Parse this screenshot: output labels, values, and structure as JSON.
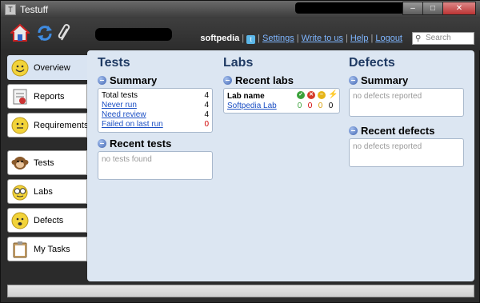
{
  "window": {
    "title": "Testuff",
    "controls": [
      "–",
      "□",
      "✕"
    ]
  },
  "topbar": {
    "username": "softpedia",
    "links": [
      "Settings",
      "Write to us",
      "Help",
      "Logout"
    ],
    "search_placeholder": "Search"
  },
  "sidebar": {
    "items": [
      {
        "label": "Overview",
        "icon": "smiley-icon"
      },
      {
        "label": "Reports",
        "icon": "report-icon"
      },
      {
        "label": "Requirements",
        "icon": "smiley-icon"
      },
      {
        "label": "Tests",
        "icon": "monkey-icon"
      },
      {
        "label": "Labs",
        "icon": "glasses-icon"
      },
      {
        "label": "Defects",
        "icon": "bug-icon"
      },
      {
        "label": "My Tasks",
        "icon": "clipboard-icon"
      }
    ]
  },
  "tests": {
    "heading": "Tests",
    "summary_title": "Summary",
    "summary": [
      {
        "label": "Total tests",
        "value": "4",
        "link": false
      },
      {
        "label": "Never run",
        "value": "4",
        "link": true
      },
      {
        "label": "Need review",
        "value": "4",
        "link": true
      },
      {
        "label": "Failed on last run",
        "value": "0",
        "link": true
      }
    ],
    "recent_title": "Recent tests",
    "recent_empty": "no tests found"
  },
  "labs": {
    "heading": "Labs",
    "recent_title": "Recent labs",
    "column_label": "Lab name",
    "rows": [
      {
        "name": "Softpedia Lab",
        "passed": "0",
        "failed": "0",
        "blocked": "0",
        "other": "0"
      }
    ]
  },
  "defects": {
    "heading": "Defects",
    "summary_title": "Summary",
    "summary_empty": "no defects reported",
    "recent_title": "Recent defects",
    "recent_empty": "no defects reported"
  },
  "colors": {
    "heading": "#1f3a63",
    "link": "#1b4fc4",
    "panel": "#dce6f2",
    "failed": "#d00000"
  }
}
